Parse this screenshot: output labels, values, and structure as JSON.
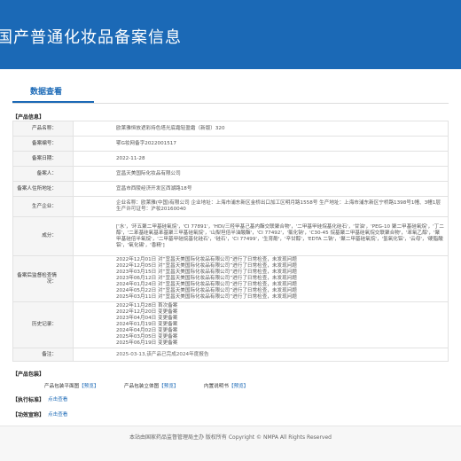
{
  "header": {
    "title": "国产普通化妆品备案信息"
  },
  "tab": {
    "label": "数据查看"
  },
  "section": {
    "product_info": "【产品信息】"
  },
  "rows": [
    {
      "label": "产品名称：",
      "value": "欧莱雅恒放遮彩持色塔光底霜轻盈霜（新版）320"
    },
    {
      "label": "备案编号：",
      "value": "鄂G妆网备字2022001517"
    },
    {
      "label": "备案日期：",
      "value": "2022-11-28"
    },
    {
      "label": "备案人：",
      "value": "宜昌天美国际化妆品有限公司"
    },
    {
      "label": "备案人住所地址：",
      "value": "宜昌市西陵经济开发区西湖路18号"
    },
    {
      "label": "生产企业：",
      "value": "企业名称：欧莱雅(中国)有限公司 企业地址：上海市浦东新区金桥出口加工区明月路1558号 生产地址：上海市浦东新区宁桥路1398号1幢、3幢1层 生产许可证号：沪妆20160040"
    },
    {
      "label": "成分：",
      "value": "['水'，'环五聚二甲基硅氧烷'，'CI 77891'，'HDI/三羟甲基己基内酯交联聚合物'，'二甲基甲硅烷基化硅石'，'甘油'，'PEG-10 聚二甲基硅氧烷'，'丁二醇'，'二苯基硅氧基苯基聚三甲基硅氧烷'，'山梨坦倍半油酸酯'，'CI 77492'，'氯化钠'，'C30-45 烷基聚二甲基硅氧烷交联聚合物'，'苯氧乙醇'，'聚甲基硅倍半氧烷'，'二甲基甲硅烷基化硅石'，'硅石'，'CI 77499'，'生育酚'，'辛甘醇'，'EDTA 二钠'，'聚二甲基硅氧烷'，'氢氧化铝'，'云母'，'硬脂酸铝'，'氧化锡'，'香精']"
    },
    {
      "label": "备案后监督检查情况：",
      "value": "2022年12月01日 对“宜昌天美国际化妆品有限公司”进行了日常检查，未发现问题\n2022年12月05日 对“宜昌天美国际化妆品有限公司”进行了日常检查，未发现问题\n2023年03月15日 对“宜昌天美国际化妆品有限公司”进行了日常检查，未发现问题\n2023年06月12日 对“宜昌天美国际化妆品有限公司”进行了日常检查，未发现问题\n2024年01月24日 对“宜昌天美国际化妆品有限公司”进行了日常检查，未发现问题\n2024年05月22日 对“宜昌天美国际化妆品有限公司”进行了日常检查，未发现问题\n2025年03月11日 对“宜昌天美国际化妆品有限公司”进行了日常检查，未发现问题"
    },
    {
      "label": "历史记录：",
      "value": "2022年11月28日 首次备案\n2022年12月20日 变更备案\n2023年04月04日 变更备案\n2024年01月19日 变更备案\n2024年04月02日 变更备案\n2025年03月05日 变更备案\n2025年06月19日 变更备案"
    },
    {
      "label": "备注：",
      "value": "2025-03-13,该产品已完成2024年度报告"
    }
  ],
  "pack": {
    "title": "【产品包装】",
    "items": [
      {
        "label": "产品包装平面图",
        "link": "【预览】"
      },
      {
        "label": "产品包装立体图",
        "link": "【预览】"
      },
      {
        "label": "内置说明书",
        "link": "【预览】"
      }
    ]
  },
  "exec": {
    "title": "【执行标准】",
    "link": "点击查看"
  },
  "efficacy": {
    "title": "【功效宣称】",
    "link": "点击查看"
  },
  "footer": {
    "text": "本站由国家药品监督管理局主办 版权所有 Copyright © NMPA All Rights Reserved"
  }
}
